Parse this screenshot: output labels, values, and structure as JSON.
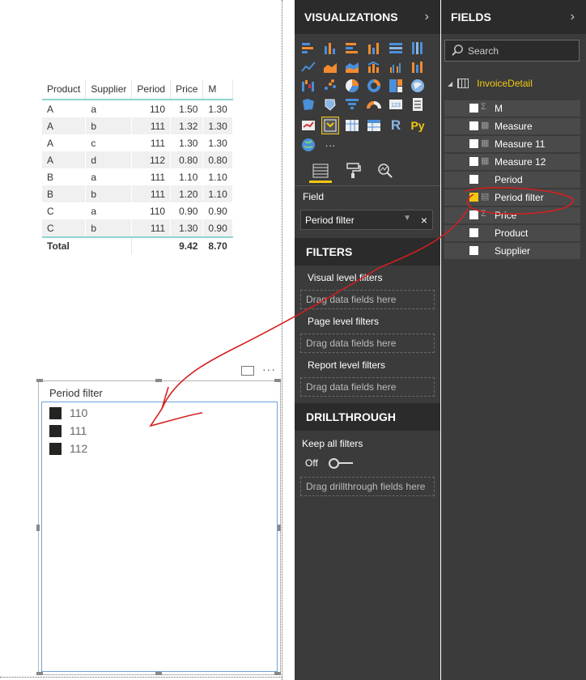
{
  "table_visual": {
    "headers": [
      "Product",
      "Supplier",
      "Period",
      "Price",
      "M"
    ],
    "rows": [
      [
        "A",
        "a",
        "110",
        "1.50",
        "1.30"
      ],
      [
        "A",
        "b",
        "111",
        "1.32",
        "1.30"
      ],
      [
        "A",
        "c",
        "111",
        "1.30",
        "1.30"
      ],
      [
        "A",
        "d",
        "112",
        "0.80",
        "0.80"
      ],
      [
        "B",
        "a",
        "111",
        "1.10",
        "1.10"
      ],
      [
        "B",
        "b",
        "111",
        "1.20",
        "1.10"
      ],
      [
        "C",
        "a",
        "110",
        "0.90",
        "0.90"
      ],
      [
        "C",
        "b",
        "111",
        "1.30",
        "0.90"
      ]
    ],
    "total_label": "Total",
    "total_price": "9.42",
    "total_m": "8.70"
  },
  "slicer": {
    "title": "Period filter",
    "items": [
      "110",
      "111",
      "112"
    ],
    "more_label": "···"
  },
  "visualizations": {
    "title": "VISUALIZATIONS",
    "chevron": "›",
    "r_label": "R",
    "py_label": "Py",
    "more_label": "···",
    "field_label": "Field",
    "field_value": "Period filter",
    "field_remove": "×",
    "filters_title": "FILTERS",
    "visual_level": "Visual level filters",
    "page_level": "Page level filters",
    "report_level": "Report level filters",
    "drop_hint": "Drag data fields here",
    "drillthrough_title": "DRILLTHROUGH",
    "keep_all_filters": "Keep all filters",
    "toggle_state": "Off",
    "drillthrough_hint": "Drag drillthrough fields here"
  },
  "fields": {
    "title": "FIELDS",
    "chevron": "›",
    "search_placeholder": "Search",
    "table_name": "InvoiceDetail",
    "items": [
      {
        "label": "M",
        "symbol": "Σ",
        "checked": false
      },
      {
        "label": "Measure",
        "symbol": "▦",
        "checked": false
      },
      {
        "label": "Measure 11",
        "symbol": "▦",
        "checked": false
      },
      {
        "label": "Measure 12",
        "symbol": "▦",
        "checked": false
      },
      {
        "label": "Period",
        "symbol": "",
        "checked": false
      },
      {
        "label": "Period filter",
        "symbol": "▤",
        "checked": true
      },
      {
        "label": "Price",
        "symbol": "Σ",
        "checked": false
      },
      {
        "label": "Product",
        "symbol": "",
        "checked": false
      },
      {
        "label": "Supplier",
        "symbol": "",
        "checked": false
      }
    ]
  },
  "colors": {
    "pane_bg": "#3b3b3b",
    "header_bg": "#2b2b2b",
    "accent": "#f2c811",
    "annotation": "#d42020"
  }
}
